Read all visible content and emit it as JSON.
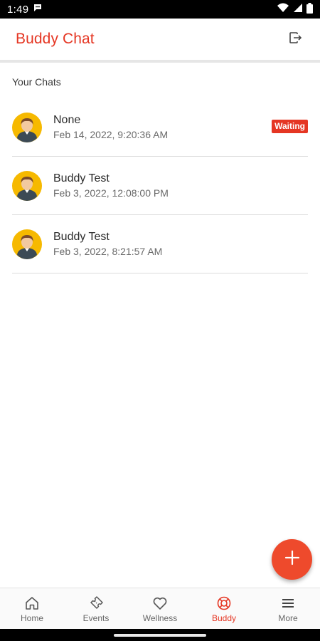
{
  "status_bar": {
    "time": "1:49"
  },
  "app_bar": {
    "title": "Buddy Chat"
  },
  "section_label": "Your Chats",
  "chats": [
    {
      "name": "None",
      "date": "Feb 14, 2022, 9:20:36 AM",
      "badge": "Waiting"
    },
    {
      "name": "Buddy Test",
      "date": "Feb 3, 2022, 12:08:00 PM",
      "badge": ""
    },
    {
      "name": "Buddy Test",
      "date": "Feb 3, 2022, 8:21:57 AM",
      "badge": ""
    }
  ],
  "bottom_nav": {
    "items": [
      {
        "label": "Home",
        "icon": "home-icon"
      },
      {
        "label": "Events",
        "icon": "ticket-icon"
      },
      {
        "label": "Wellness",
        "icon": "heart-icon"
      },
      {
        "label": "Buddy",
        "icon": "lifebuoy-icon",
        "active": true
      },
      {
        "label": "More",
        "icon": "menu-icon"
      }
    ]
  },
  "colors": {
    "accent": "#e53623",
    "fab": "#ee4a2c",
    "avatar_bg": "#f6b900"
  }
}
